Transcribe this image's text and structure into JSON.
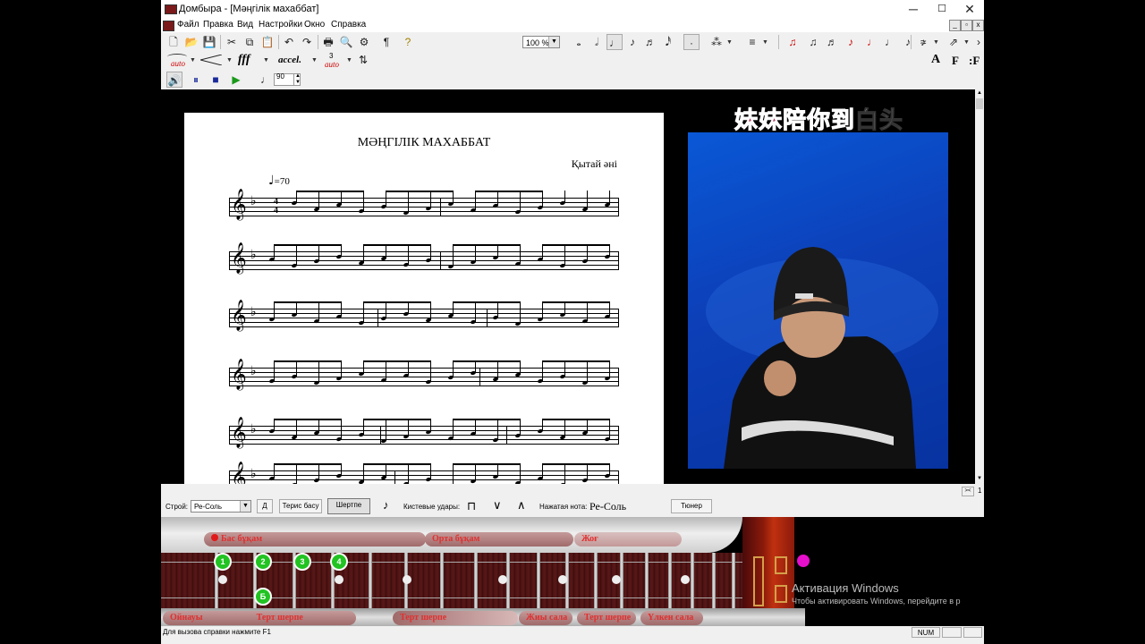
{
  "window": {
    "title": "Домбыра - [Мәңгілік махаббат]",
    "controls": [
      "─",
      "☐",
      "✕"
    ]
  },
  "menu": {
    "items": [
      "Файл",
      "Правка",
      "Вид",
      "Настройки",
      "Окно",
      "Справка"
    ],
    "mdi_controls": [
      "_",
      "▫",
      "x"
    ]
  },
  "toolbar": {
    "zoom": "100 %",
    "dynamics_auto": "auto",
    "fff": "fff",
    "accel": "accel.",
    "tuplet_label": "3",
    "font_buttons": [
      "A",
      "F",
      "F"
    ],
    "tempo_value": "90"
  },
  "score": {
    "title": "МӘҢГІЛІК МАХАББАТ",
    "composer": "Қытай әні",
    "tempo": "=70",
    "time_signature_top": "4",
    "time_signature_bottom": "4"
  },
  "video": {
    "lyrics_highlighted": "妹妹陪你到",
    "lyrics_normal": "白头"
  },
  "controls": {
    "tuning_label": "Строй:",
    "tuning_value": "Ре-Соль",
    "btn_d": "Д",
    "btn_reverse": "Терис басу",
    "btn_shertpe": "Шертпе",
    "strokes_label": "Кистевые удары:",
    "pressed_note_label": "Нажатая нота:",
    "pressed_note_value": "Ре-Соль",
    "tuner_button": "Тюнер",
    "scroll_right_label": "><",
    "scroll_right_num": "1"
  },
  "fretboard": {
    "top_bars": [
      "Бас бұқам",
      "Орта бұқам",
      "Жоғ"
    ],
    "bottom_bars": [
      "Ойнауы",
      "Терт шерпе",
      "Терт шерпе",
      "Жиы сала",
      "Терт шерпе",
      "Үлкен сала"
    ],
    "finger_labels": [
      "1",
      "2",
      "3",
      "4",
      "Б"
    ]
  },
  "status": {
    "help_text": "Для вызова справки нажмите F1",
    "num": "NUM"
  },
  "activation": {
    "title": "Активация Windows",
    "subtitle": "Чтобы активировать Windows, перейдите в р"
  }
}
